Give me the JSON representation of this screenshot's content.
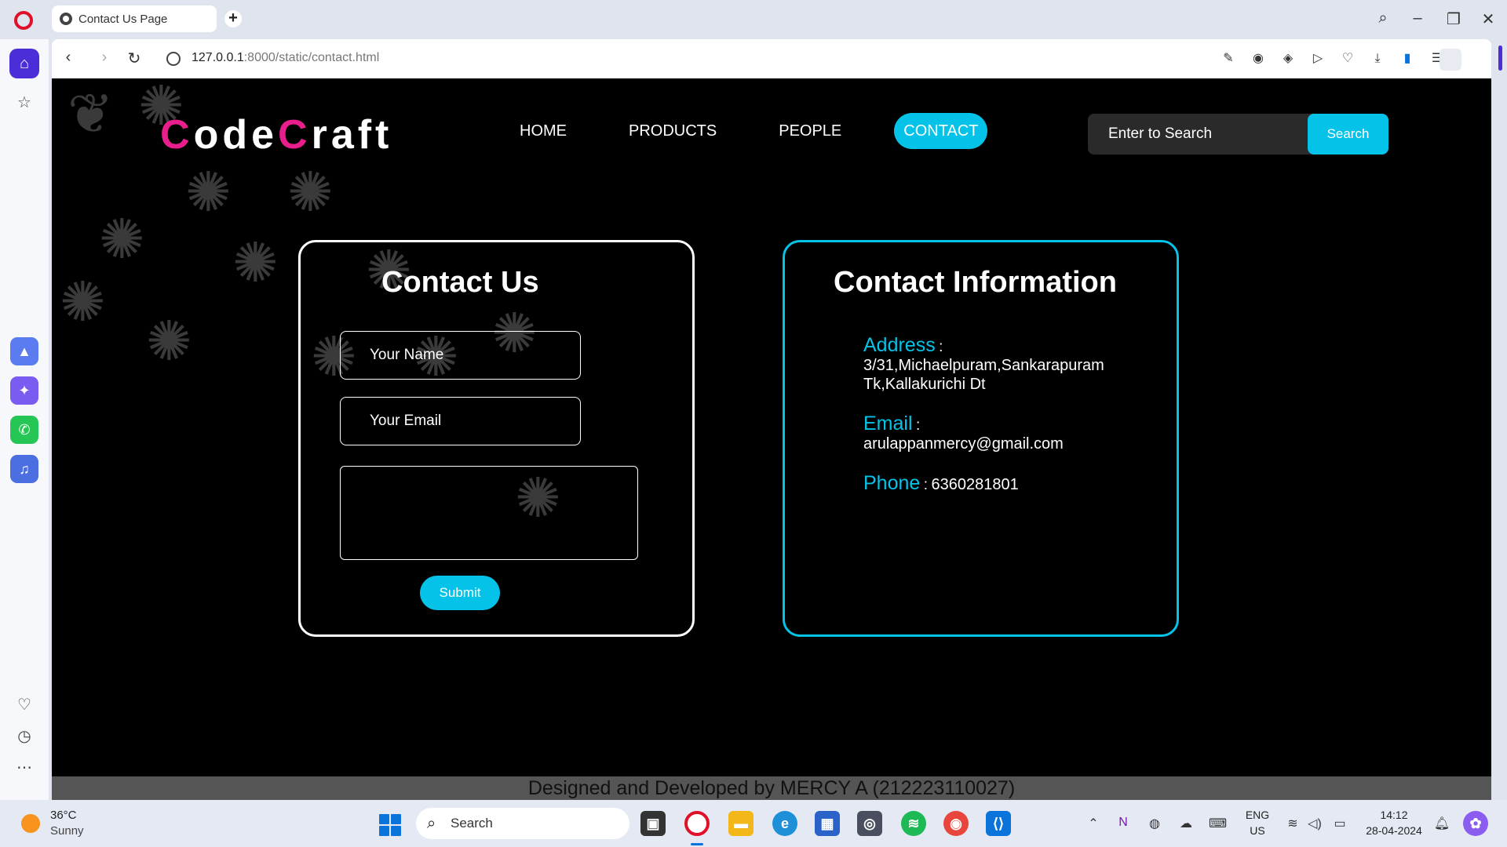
{
  "browser": {
    "tab_title": "Contact Us Page",
    "new_tab": "+",
    "url_host": "127.0.0.1",
    "url_path": ":8000/static/contact.html",
    "accent": "#4b2ed8"
  },
  "site": {
    "logo_c1": "C",
    "logo_rest1": "ode",
    "logo_c2": "C",
    "logo_rest2": "raft",
    "nav": [
      {
        "label": "HOME"
      },
      {
        "label": "PRODUCTS"
      },
      {
        "label": "PEOPLE"
      },
      {
        "label": "CONTACT"
      }
    ],
    "search_placeholder": "Enter to Search",
    "search_button": "Search",
    "accent_color": "#05c3e8",
    "logo_color": "#e91e8c"
  },
  "contact_form": {
    "title": "Contact Us",
    "name_placeholder": "Your Name",
    "email_placeholder": "Your Email",
    "submit_label": "Submit"
  },
  "contact_info": {
    "title": "Contact Information",
    "address_label": "Address",
    "address_line1": "3/31,Michaelpuram,Sankarapuram",
    "address_line2": "Tk,Kallakurichi Dt",
    "email_label": "Email",
    "email_value": "arulappanmercy@gmail.com",
    "phone_label": "Phone",
    "phone_value": "6360281801",
    "colon": ":"
  },
  "footer": {
    "text": "Designed and Developed by MERCY A (212223110027)"
  },
  "taskbar": {
    "temperature": "36°C",
    "weather": "Sunny",
    "search_label": "Search",
    "lang1": "ENG",
    "lang2": "US",
    "time": "14:12",
    "date": "28-04-2024"
  }
}
